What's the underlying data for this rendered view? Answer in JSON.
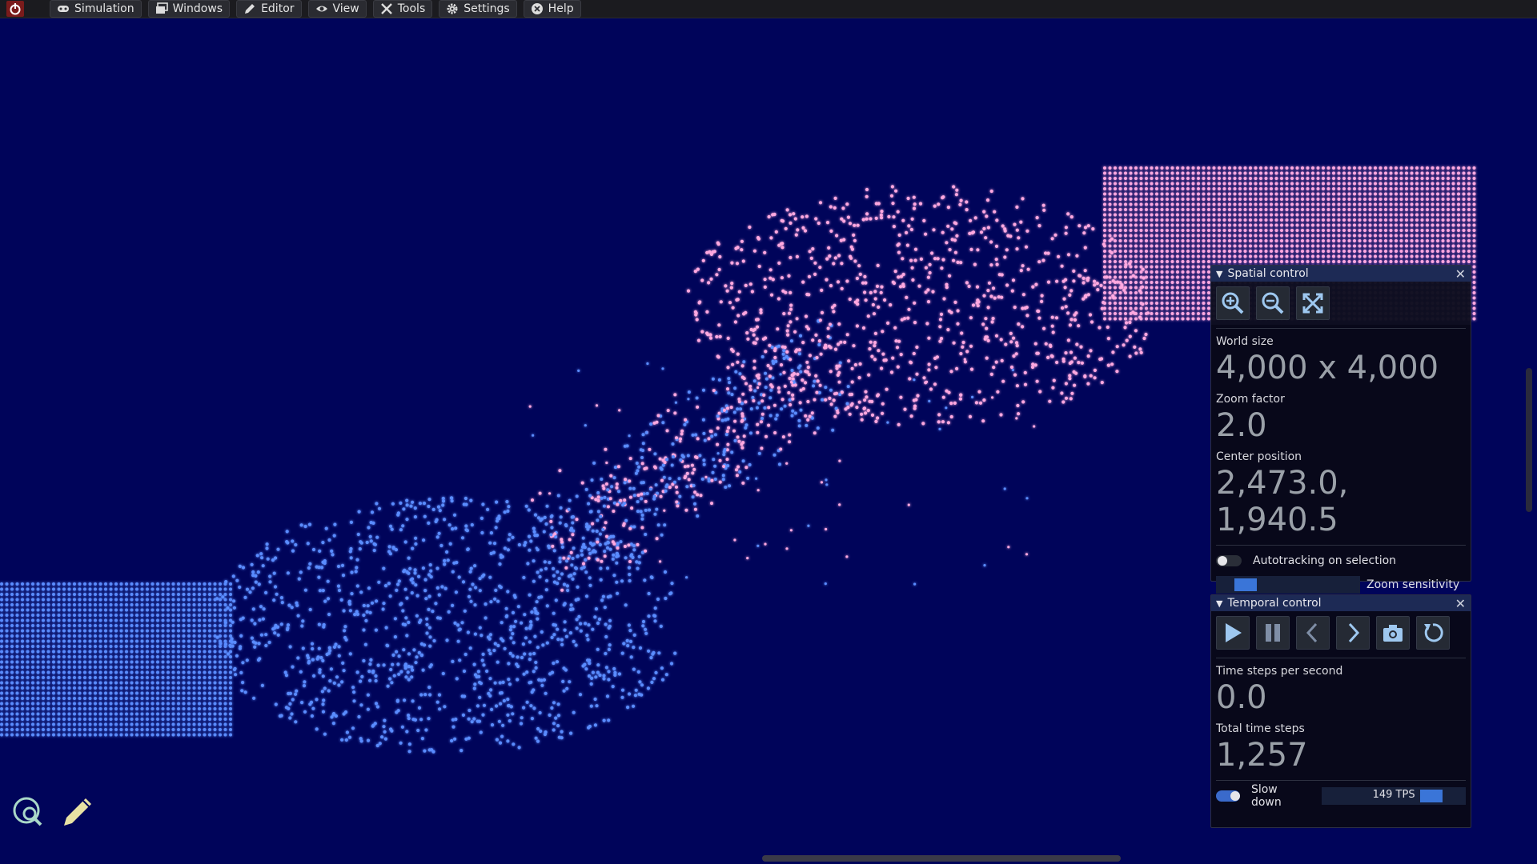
{
  "menu": {
    "items": [
      {
        "key": "simulation",
        "label": "Simulation"
      },
      {
        "key": "windows",
        "label": "Windows"
      },
      {
        "key": "editor",
        "label": "Editor"
      },
      {
        "key": "view",
        "label": "View"
      },
      {
        "key": "tools",
        "label": "Tools"
      },
      {
        "key": "settings",
        "label": "Settings"
      },
      {
        "key": "help",
        "label": "Help"
      }
    ]
  },
  "spatial": {
    "title": "Spatial control",
    "world_size_label": "World size",
    "world_size_value": "4,000 x 4,000",
    "zoom_factor_label": "Zoom factor",
    "zoom_factor_value": "2.0",
    "center_label": "Center position",
    "center_value": "2,473.0, 1,940.5",
    "autotracking_label": "Autotracking on selection",
    "autotracking_on": false,
    "zoom_sensitivity_label": "Zoom sensitivity",
    "zoom_sensitivity_level": 0.15
  },
  "temporal": {
    "title": "Temporal control",
    "tps_label": "Time steps per second",
    "tps_value": "0.0",
    "total_label": "Total time steps",
    "total_value": "1,257",
    "slowdown_label": "Slow down",
    "slowdown_on": true,
    "slowdown_tps": "149 TPS",
    "slowdown_level": 0.75
  },
  "colors": {
    "background": "#00045a",
    "particle_blue": "#5a8cff",
    "particle_pink": "#ffa8e0",
    "accent": "#3a75d8"
  },
  "icons": [
    "power-icon",
    "gamepad-icon",
    "windows-icon",
    "pencil-icon",
    "eye-icon",
    "tools-icon",
    "gear-icon",
    "help-icon",
    "zoom-in-icon",
    "zoom-out-icon",
    "fit-icon",
    "play-icon",
    "pause-icon",
    "step-back-icon",
    "step-forward-icon",
    "snapshot-icon",
    "restore-icon",
    "inspect-icon",
    "edit-icon"
  ]
}
